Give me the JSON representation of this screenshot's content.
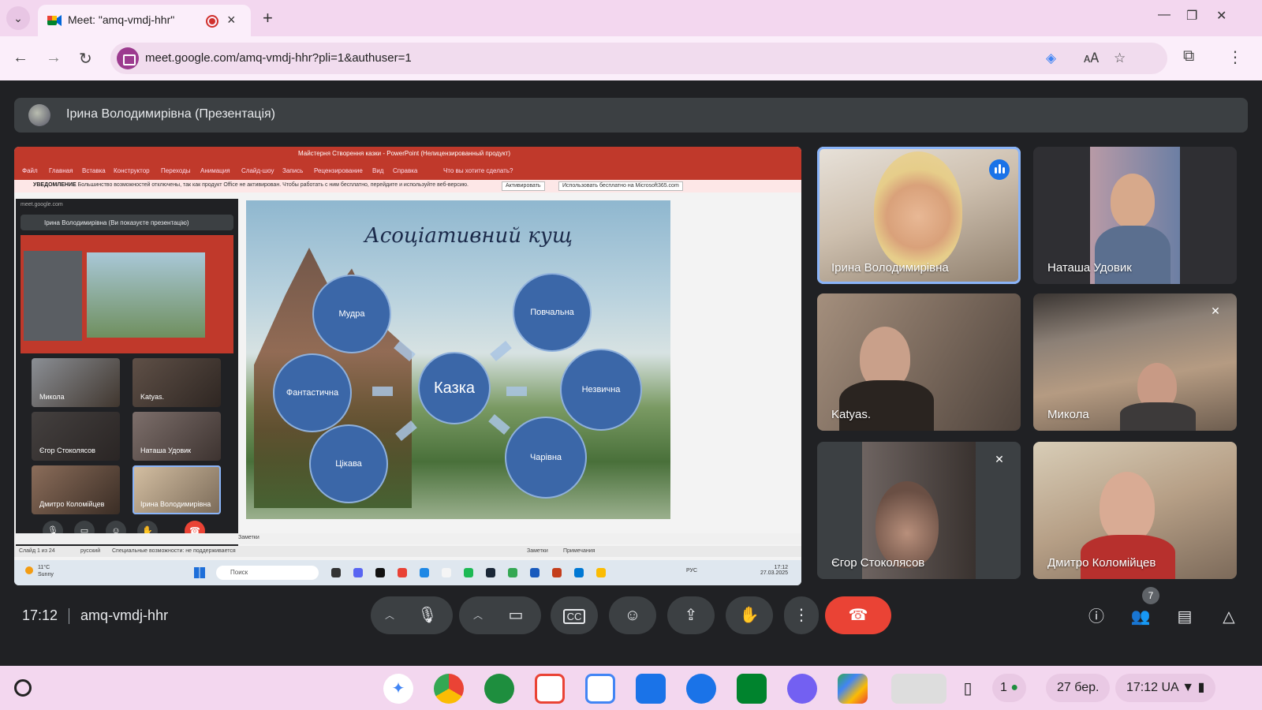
{
  "browser": {
    "tab_title": "Meet: \"amq-vmdj-hhr\"",
    "url": "meet.google.com/amq-vmdj-hhr?pli=1&authuser=1"
  },
  "presentation": {
    "banner": "Ірина Володимирівна (Презентація)",
    "ppt_title": "Майстерня Створення казки - PowerPoint (Нелицензированный продукт)",
    "ribbon_tabs": [
      "Файл",
      "Главная",
      "Вставка",
      "Конструктор",
      "Переходы",
      "Анимация",
      "Слайд-шоу",
      "Запись",
      "Рецензирование",
      "Вид",
      "Справка",
      "Что вы хотите сделать?"
    ],
    "notice_label": "УВЕДОМЛЕНИЕ",
    "notice_text": "Большинство возможностей отключены, так как продукт Office не активирован. Чтобы работать с ним бесплатно, перейдите и используйте веб-версию.",
    "notice_btn1": "Активировать",
    "notice_btn2": "Использовать бесплатно на Microsoft365.com",
    "slide": {
      "title": "Асоціативний кущ",
      "center": "Казка",
      "words": [
        "Мудра",
        "Повчальна",
        "Фантастична",
        "Незвична",
        "Цікава",
        "Чарівна"
      ]
    },
    "notes_label": "Заметки",
    "status_left": "Слайд 1 из 24",
    "status_lang": "русский",
    "status_access": "Специальные возможности: не поддерживается",
    "status_notes": "Заметки",
    "status_comments": "Примечания",
    "taskbar": {
      "weather_temp": "11°C",
      "weather_desc": "Sunny",
      "search": "Поиск",
      "lang": "РУС",
      "time": "17:12",
      "date": "27.03.2025"
    },
    "mini_meet": {
      "url": "meet.google.com",
      "header": "Ірина Володимирівна (Ви показуєте презентацію)",
      "tiles": [
        "Микола",
        "Katyas.",
        "Єгор Стоколясов",
        "Наташа Удовик",
        "Дмитро Коломійцев",
        "Ірина Володимирівна"
      ]
    }
  },
  "participants": [
    {
      "name": "Ірина Володимирівна",
      "speaking": true
    },
    {
      "name": "Наташа Удовик"
    },
    {
      "name": "Katyas."
    },
    {
      "name": "Микола",
      "muted": true
    },
    {
      "name": "Єгор Стоколясов",
      "muted": true
    },
    {
      "name": "Дмитро Коломійцев"
    }
  ],
  "meeting": {
    "time": "17:12",
    "code": "amq-vmdj-hhr",
    "people_count": "7"
  },
  "shelf": {
    "date": "27 бер.",
    "time": "17:12",
    "locale": "UA",
    "notif_count": "1"
  },
  "colors": {
    "accent": "#1a73e8",
    "end_call": "#ea4335",
    "ppt": "#c0392b",
    "bubble": "#3b67a8"
  }
}
